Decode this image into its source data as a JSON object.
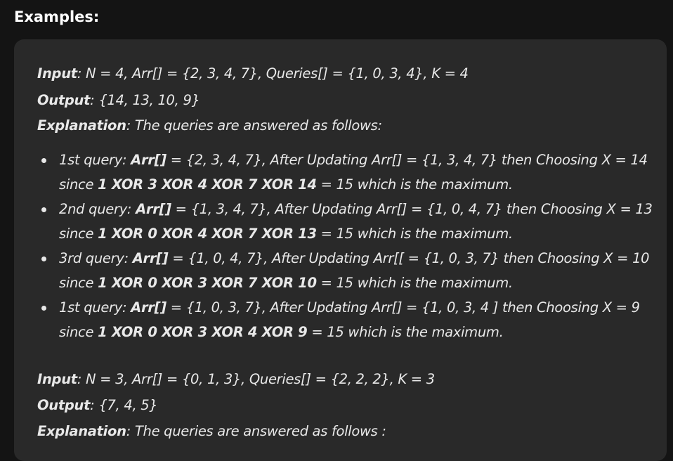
{
  "heading": "Examples:",
  "example1": {
    "input_label": "Input",
    "input_text": ": N = 4, Arr[] = {2, 3, 4, 7}, Queries[] = {1, 0, 3, 4}, K = 4",
    "output_label": "Output",
    "output_text": ": {14, 13, 10, 9}",
    "explanation_label": "Explanation",
    "explanation_text": ": The queries are answered as follows:",
    "bullets": [
      {
        "a": "1st query: ",
        "b1": "Arr[]",
        "c": " = {2, 3, 4, 7}, After Updating Arr[] = {1, 3, 4, 7} then Choosing X = 14",
        "d": "since ",
        "b2": "1 XOR 3 XOR 4 XOR 7 XOR 14",
        "e": " = 15 which is the maximum."
      },
      {
        "a": "2nd query: ",
        "b1": "Arr[]",
        "c": " = {1, 3, 4, 7}, After Updating Arr[] = {1, 0, 4, 7} then Choosing X = 13",
        "d": "since ",
        "b2": "1 XOR 0 XOR 4 XOR 7 XOR 13",
        "e": " = 15 which is the maximum."
      },
      {
        "a": "3rd query: ",
        "b1": "Arr[]",
        "c": " = {1, 0, 4, 7}, After Updating Arr[[ = {1, 0, 3, 7} then Choosing X = 10",
        "d": "since ",
        "b2": "1 XOR 0 XOR 3 XOR 7 XOR 10",
        "e": " = 15 which is the maximum."
      },
      {
        "a": "1st query: ",
        "b1": "Arr[]",
        "c": " = {1, 0, 3, 7}, After Updating Arr[] = {1, 0, 3, 4 ] then Choosing X = 9",
        "d": "since ",
        "b2": "1 XOR 0 XOR 3 XOR 4 XOR 9",
        "e": " = 15 which is the maximum."
      }
    ]
  },
  "example2": {
    "input_label": "Input",
    "input_text": ": N = 3, Arr[] = {0, 1, 3},  Queries[] = {2, 2, 2}, K = 3",
    "output_label": "Output",
    "output_text": ": {7, 4, 5}",
    "explanation_label": "Explanation",
    "explanation_text": ": The queries are answered as follows :"
  }
}
